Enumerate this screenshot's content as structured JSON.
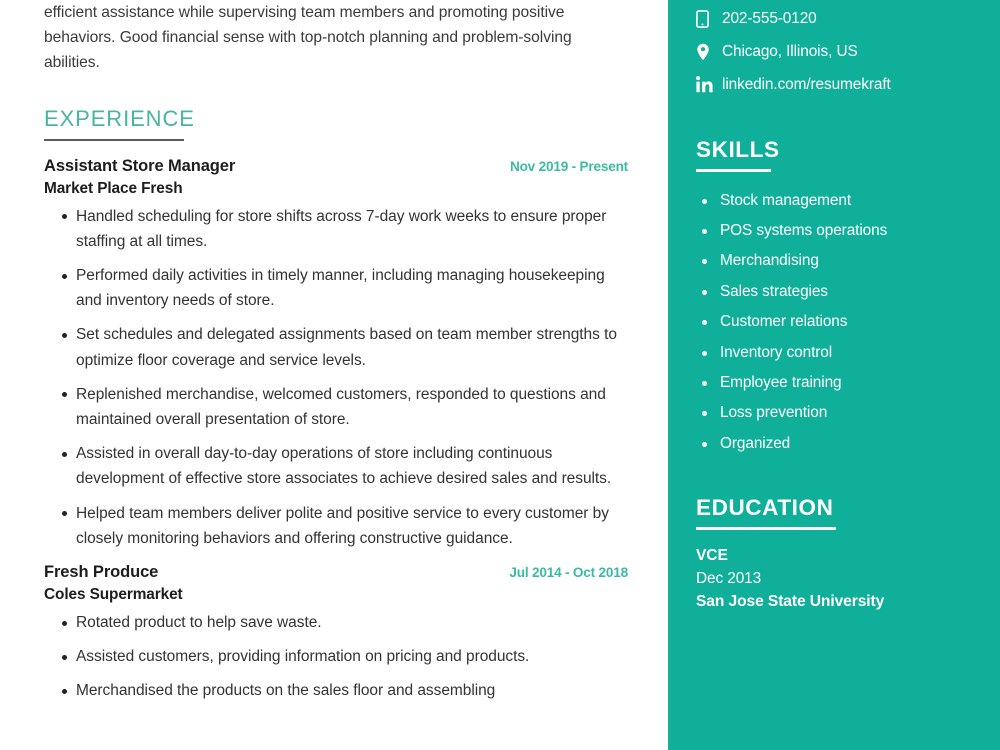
{
  "main": {
    "summary_tail": "efficient assistance while supervising team members and promoting positive behaviors. Good financial sense with top-notch planning and problem-solving abilities.",
    "experience": {
      "heading": "EXPERIENCE",
      "jobs": [
        {
          "title": "Assistant Store Manager",
          "company": "Market Place Fresh",
          "date": "Nov 2019 - Present",
          "bullets": [
            "Handled scheduling for store shifts across 7-day work weeks to ensure proper staffing at all times.",
            "Performed daily activities in timely manner, including managing housekeeping and inventory needs of store.",
            "Set schedules and delegated assignments based on team member strengths to optimize floor coverage and service levels.",
            "Replenished merchandise, welcomed customers, responded to questions and maintained overall presentation of store.",
            "Assisted in overall day-to-day operations of store including continuous development of effective store associates to achieve desired sales and results.",
            "Helped team members deliver polite and positive service to every customer by closely monitoring behaviors and offering constructive guidance."
          ]
        },
        {
          "title": "Fresh Produce",
          "company": "Coles Supermarket",
          "date": "Jul 2014 - Oct 2018",
          "bullets": [
            "Rotated product to help save waste.",
            "Assisted customers, providing information on pricing and products.",
            "Merchandised the products on the sales floor and assembling"
          ]
        }
      ]
    }
  },
  "sidebar": {
    "contact": [
      {
        "icon": "mobile-phone-icon",
        "value": "202-555-0120"
      },
      {
        "icon": "location-pin-icon",
        "value": "Chicago, Illinois, US"
      },
      {
        "icon": "linkedin-icon",
        "value": "linkedin.com/resumekraft"
      }
    ],
    "skills": {
      "heading": "SKILLS",
      "items": [
        "Stock management",
        "POS systems operations",
        "Merchandising",
        "Sales strategies",
        "Customer relations",
        "Inventory control",
        "Employee training",
        "Loss prevention",
        "Organized"
      ]
    },
    "education": {
      "heading": "EDUCATION",
      "entries": [
        {
          "degree": "VCE",
          "date": "Dec 2013",
          "school": "San Jose State University"
        }
      ]
    }
  },
  "colors": {
    "sidebar_background": "#10af9a",
    "heading_accent": "#49b5a0",
    "date_accent": "#3dbaa2",
    "body_text": "#333333",
    "sidebar_text": "#ffffff"
  }
}
